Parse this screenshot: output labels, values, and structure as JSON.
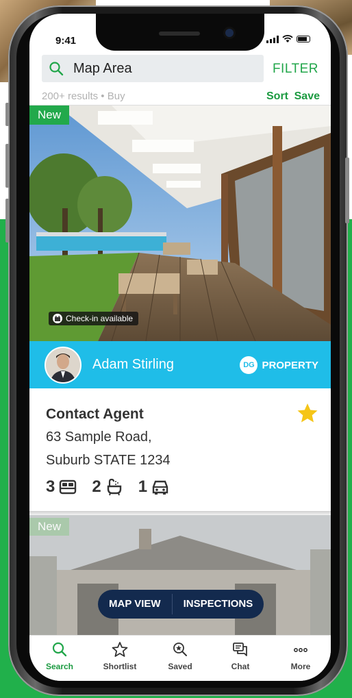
{
  "status_bar": {
    "time": "9:41"
  },
  "search": {
    "text": "Map Area",
    "filter_label": "FILTER"
  },
  "results": {
    "summary": "200+ results • Buy",
    "sort_label": "Sort",
    "save_label": "Save"
  },
  "listing": {
    "badge": "New",
    "checkin": "Check-in available",
    "agent_name": "Adam Stirling",
    "agency_logo": {
      "initials": "DG",
      "name": "PROPERTY"
    },
    "price": "Contact Agent",
    "address_line1": "63 Sample Road,",
    "address_line2": "Suburb STATE 1234",
    "bedrooms": "3",
    "bathrooms": "2",
    "parking": "1"
  },
  "listing2": {
    "badge": "New"
  },
  "view_toggle": {
    "map_view": "MAP VIEW",
    "inspections": "INSPECTIONS"
  },
  "tabs": [
    {
      "label": "Search",
      "icon": "search-icon"
    },
    {
      "label": "Shortlist",
      "icon": "star-icon"
    },
    {
      "label": "Saved",
      "icon": "saved-search-icon"
    },
    {
      "label": "Chat",
      "icon": "chat-icon"
    },
    {
      "label": "More",
      "icon": "more-icon"
    }
  ],
  "colors": {
    "accent_green": "#21a64a",
    "agent_bar_blue": "#1fbde8",
    "toggle_navy": "#132a4e",
    "star_yellow": "#f5c518"
  }
}
